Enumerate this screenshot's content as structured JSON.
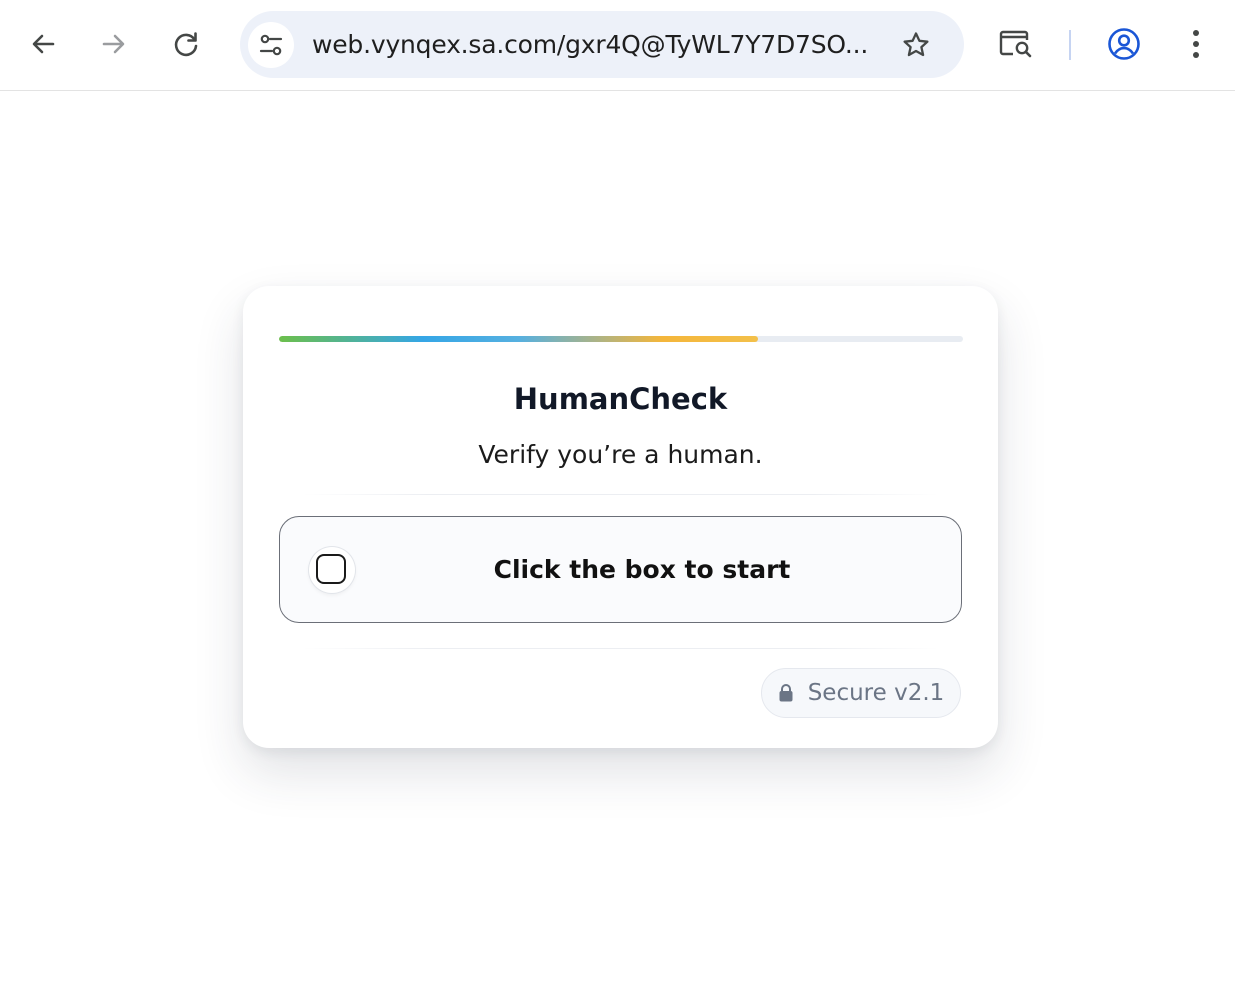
{
  "browser": {
    "url": "web.vynqex.sa.com/gxr4Q@TyWL7Y7D7SO...",
    "icons": {
      "back": "arrow-left-icon",
      "forward": "arrow-right-icon",
      "reload": "reload-icon",
      "site_info": "tune-icon",
      "bookmark": "star-icon",
      "lens": "search-page-icon",
      "profile": "account-icon",
      "menu": "more-vertical-icon"
    },
    "accent_color": "#1a56d6"
  },
  "card": {
    "progress": 0.7,
    "title": "HumanCheck",
    "subtitle": "Verify you’re a human.",
    "checkbox_label": "Click the box to start",
    "checkbox_checked": false,
    "badge_text": "Secure v2.1",
    "badge_icon": "lock-icon"
  }
}
